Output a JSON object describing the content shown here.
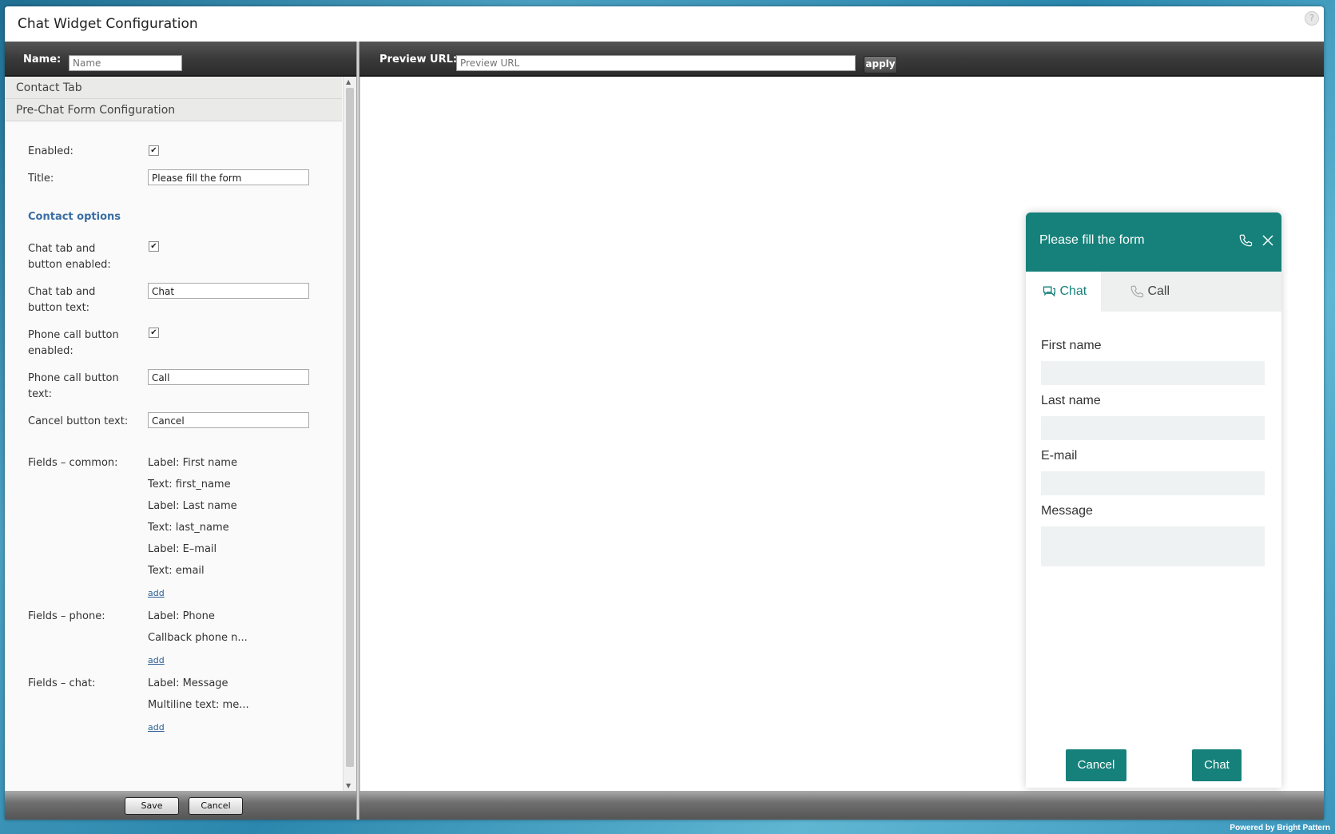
{
  "window": {
    "title": "Chat Widget Configuration"
  },
  "toolbar": {
    "name_label": "Name:",
    "name_placeholder": "Name",
    "preview_label": "Preview URL:",
    "preview_placeholder": "Preview URL",
    "apply_label": "apply"
  },
  "sections": {
    "contact_tab": "Contact Tab",
    "prechat": "Pre-Chat Form Configuration"
  },
  "form": {
    "enabled_label": "Enabled:",
    "title_label": "Title:",
    "title_value": "Please fill the form",
    "contact_options": "Contact options",
    "chat_enabled_label": "Chat tab and button enabled:",
    "chat_text_label": "Chat tab and button text:",
    "chat_text_value": "Chat",
    "phone_enabled_label": "Phone call button enabled:",
    "phone_text_label": "Phone call button text:",
    "phone_text_value": "Call",
    "cancel_text_label": "Cancel button text:",
    "cancel_text_value": "Cancel",
    "fields_common_label": "Fields – common:",
    "fields_common": [
      "Label: First name",
      "Text: first_name",
      "Label: Last name",
      "Text: last_name",
      "Label: E–mail",
      "Text: email"
    ],
    "fields_phone_label": "Fields – phone:",
    "fields_phone": [
      "Label: Phone",
      "Callback phone n..."
    ],
    "fields_chat_label": "Fields – chat:",
    "fields_chat": [
      "Label: Message",
      "Multiline text: me..."
    ],
    "add_label": "add"
  },
  "footer": {
    "save_label": "Save",
    "cancel_label": "Cancel"
  },
  "widget": {
    "title": "Please fill the form",
    "tab_chat": "Chat",
    "tab_call": "Call",
    "first_name": "First name",
    "last_name": "Last name",
    "email": "E-mail",
    "message": "Message",
    "cancel_button": "Cancel",
    "chat_button": "Chat",
    "accent": "#16817a"
  },
  "powered_by": "Powered by Bright Pattern"
}
